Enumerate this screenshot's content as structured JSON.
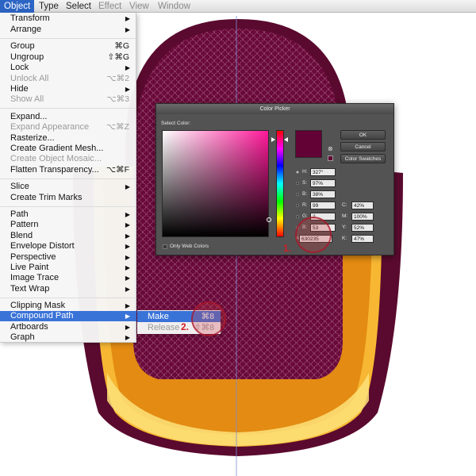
{
  "menubar": {
    "items": [
      "Object",
      "Type",
      "Select",
      "Effect",
      "View",
      "Window"
    ]
  },
  "object_menu": {
    "items": [
      {
        "label": "Transform",
        "submenu": true
      },
      {
        "label": "Arrange",
        "submenu": true
      },
      {
        "label": "Group",
        "shortcut": "⌘G"
      },
      {
        "label": "Ungroup",
        "shortcut": "⇧⌘G"
      },
      {
        "label": "Lock",
        "submenu": true
      },
      {
        "label": "Unlock All",
        "shortcut": "⌥⌘2",
        "disabled": true
      },
      {
        "label": "Hide",
        "submenu": true
      },
      {
        "label": "Show All",
        "shortcut": "⌥⌘3",
        "disabled": true
      },
      {
        "label": "Expand..."
      },
      {
        "label": "Expand Appearance",
        "shortcut": "⌥⌘Z",
        "disabled": true
      },
      {
        "label": "Rasterize..."
      },
      {
        "label": "Create Gradient Mesh..."
      },
      {
        "label": "Create Object Mosaic...",
        "disabled": true
      },
      {
        "label": "Flatten Transparency...",
        "shortcut": "⌥⌘F"
      },
      {
        "label": "Slice",
        "submenu": true
      },
      {
        "label": "Create Trim Marks"
      },
      {
        "label": "Path",
        "submenu": true
      },
      {
        "label": "Pattern",
        "submenu": true
      },
      {
        "label": "Blend",
        "submenu": true
      },
      {
        "label": "Envelope Distort",
        "submenu": true
      },
      {
        "label": "Perspective",
        "submenu": true
      },
      {
        "label": "Live Paint",
        "submenu": true
      },
      {
        "label": "Image Trace",
        "submenu": true
      },
      {
        "label": "Text Wrap",
        "submenu": true
      },
      {
        "label": "Clipping Mask",
        "submenu": true
      },
      {
        "label": "Compound Path",
        "submenu": true,
        "highlighted": true
      },
      {
        "label": "Artboards",
        "submenu": true
      },
      {
        "label": "Graph",
        "submenu": true
      }
    ]
  },
  "compound_path_submenu": {
    "items": [
      {
        "label": "Make",
        "shortcut": "⌘8",
        "highlighted": true
      },
      {
        "label": "Release",
        "shortcut": "⇧⌘8",
        "disabled": true
      }
    ]
  },
  "color_picker": {
    "title": "Color Picker",
    "select_color_label": "Select Color:",
    "ok_label": "OK",
    "cancel_label": "Cancel",
    "swatches_label": "Color Swatches",
    "only_web_label": "Only Web Colors",
    "hsb": [
      {
        "key": "H:",
        "value": "327°",
        "unit": ""
      },
      {
        "key": "S:",
        "value": "97%",
        "unit": ""
      },
      {
        "key": "B:",
        "value": "38%",
        "unit": ""
      }
    ],
    "rgb": [
      {
        "key": "R:",
        "value": "99"
      },
      {
        "key": "G:",
        "value": "2"
      },
      {
        "key": "B:",
        "value": "53"
      }
    ],
    "cmyk": [
      {
        "key": "C:",
        "value": "42%"
      },
      {
        "key": "M:",
        "value": "100%"
      },
      {
        "key": "Y:",
        "value": "52%"
      },
      {
        "key": "K:",
        "value": "47%"
      }
    ],
    "hex_key": "#",
    "hex_value": "630235",
    "selected_color": "#630235"
  },
  "callouts": [
    "1.",
    "2."
  ],
  "colors": {
    "maroon": "#630235",
    "helmet_dark": "#5a0a2e",
    "gold": "#f7b733",
    "gold_dark": "#e38b12",
    "gold_light": "#fde27a",
    "menu_highlight": "#3a73d8"
  }
}
